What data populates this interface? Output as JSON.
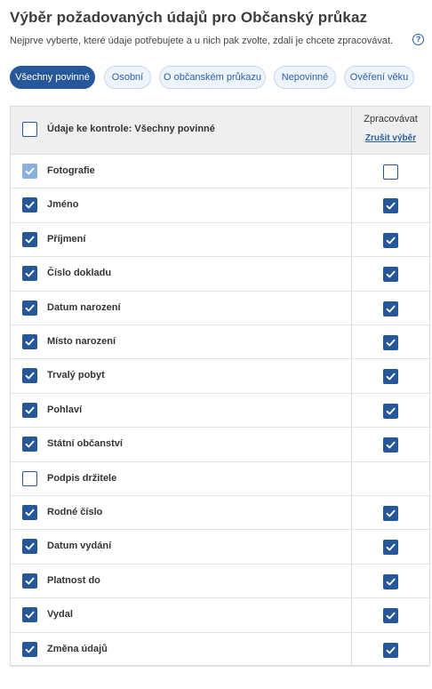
{
  "header": {
    "title": "Výběr požadovaných údajů pro Občanský průkaz",
    "subtitle": "Nejprve vyberte, které údaje potřebujete a u nich pak zvolte, zdali je chcete zpracovávat.",
    "help_icon": "?"
  },
  "filters": [
    {
      "label": "Všechny povinné",
      "active": true
    },
    {
      "label": "Osobní",
      "active": false
    },
    {
      "label": "O občanském průkazu",
      "active": false
    },
    {
      "label": "Nepovinné",
      "active": false
    },
    {
      "label": "Ověření věku",
      "active": false
    }
  ],
  "table": {
    "header_label": "Údaje ke kontrole: Všechny povinné",
    "header_checked": false,
    "process_header": "Zpracovávat",
    "clear_selection": "Zrušit výběr",
    "rows": [
      {
        "label": "Fotografie",
        "selected": true,
        "selected_disabled": true,
        "process": false,
        "has_process": true
      },
      {
        "label": "Jméno",
        "selected": true,
        "selected_disabled": false,
        "process": true,
        "has_process": true
      },
      {
        "label": "Příjmení",
        "selected": true,
        "selected_disabled": false,
        "process": true,
        "has_process": true
      },
      {
        "label": "Číslo dokladu",
        "selected": true,
        "selected_disabled": false,
        "process": true,
        "has_process": true
      },
      {
        "label": "Datum narození",
        "selected": true,
        "selected_disabled": false,
        "process": true,
        "has_process": true
      },
      {
        "label": "Místo narození",
        "selected": true,
        "selected_disabled": false,
        "process": true,
        "has_process": true
      },
      {
        "label": "Trvalý pobyt",
        "selected": true,
        "selected_disabled": false,
        "process": true,
        "has_process": true
      },
      {
        "label": "Pohlaví",
        "selected": true,
        "selected_disabled": false,
        "process": true,
        "has_process": true
      },
      {
        "label": "Státní občanství",
        "selected": true,
        "selected_disabled": false,
        "process": true,
        "has_process": true
      },
      {
        "label": "Podpis držitele",
        "selected": false,
        "selected_disabled": false,
        "process": false,
        "has_process": false
      },
      {
        "label": "Rodné číslo",
        "selected": true,
        "selected_disabled": false,
        "process": true,
        "has_process": true
      },
      {
        "label": "Datum vydání",
        "selected": true,
        "selected_disabled": false,
        "process": true,
        "has_process": true
      },
      {
        "label": "Platnost do",
        "selected": true,
        "selected_disabled": false,
        "process": true,
        "has_process": true
      },
      {
        "label": "Vydal",
        "selected": true,
        "selected_disabled": false,
        "process": true,
        "has_process": true
      },
      {
        "label": "Změna údajů",
        "selected": true,
        "selected_disabled": false,
        "process": true,
        "has_process": true
      }
    ]
  },
  "colors": {
    "accent": "#26579b",
    "muted_check": "#8ab0dc",
    "pill_bg": "#eef4fb",
    "header_bg": "#efefef"
  }
}
